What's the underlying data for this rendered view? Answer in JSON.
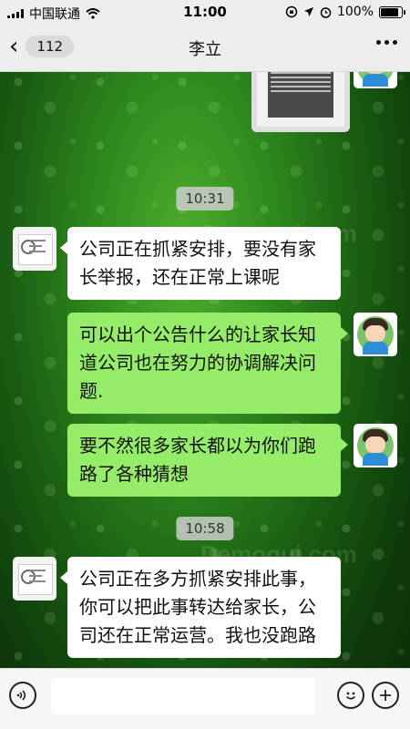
{
  "status_bar": {
    "carrier": "中国联通",
    "time": "11:00",
    "battery": "100%",
    "battery_level": 1.0
  },
  "nav": {
    "back_count": "112",
    "title": "李立"
  },
  "watermark": "Demogui.com",
  "messages": [
    {
      "type": "time",
      "text": "10:31"
    },
    {
      "side": "left",
      "text": "公司正在抓紧安排，要没有家长举报，还在正常上课呢"
    },
    {
      "side": "right",
      "text": "可以出个公告什么的让家长知道公司也在努力的协调解决问题."
    },
    {
      "side": "right",
      "text": "要不然很多家长都以为你们跑路了各种猜想"
    },
    {
      "type": "time",
      "text": "10:58"
    },
    {
      "side": "left",
      "text": "公司正在多方抓紧安排此事，你可以把此事转达给家长，公司还在正常运营。我也没跑路"
    }
  ],
  "input": {
    "placeholder": ""
  },
  "icons": {
    "voice": "voice-icon",
    "emoji": "emoji-icon",
    "plus": "plus-icon"
  },
  "colors": {
    "right_bubble": "#95ec69",
    "left_bubble": "#ffffff",
    "bar_bg": "#ededed"
  }
}
